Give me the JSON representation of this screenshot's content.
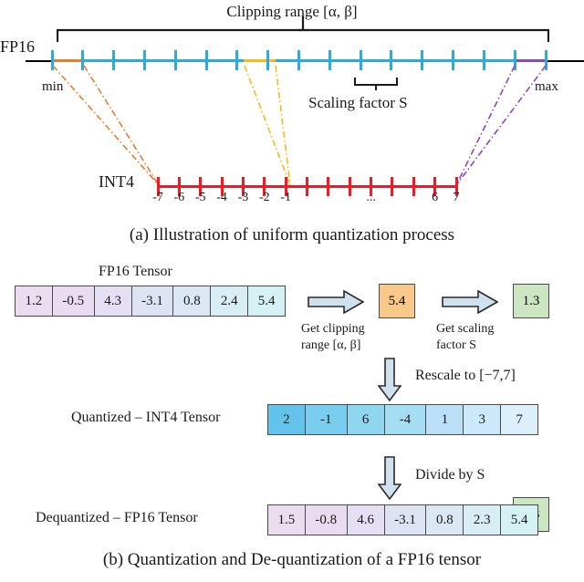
{
  "figure": {
    "caption_a": "(a)  Illustration of uniform quantization process",
    "caption_b": "(b)  Quantization and De-quantization of a FP16 tensor"
  },
  "panel_a": {
    "clipping_range_label": "Clipping range [α, β]",
    "fp16_axis_label": "FP16",
    "int4_axis_label": "INT4",
    "min_label": "min",
    "max_label": "max",
    "scaling_factor_label": "Scaling factor S",
    "int4_tick_labels": [
      "-7",
      "-6",
      "-5",
      "-4",
      "-3",
      "-2",
      "-1",
      "...",
      "6",
      "7"
    ],
    "colors": {
      "axis_black": "#000000",
      "fp16_blue": "#29abe2",
      "orange": "#f07a24",
      "yellow": "#fcb813",
      "purple": "#8e44c7",
      "int4_red": "#ed1c24"
    }
  },
  "panel_b": {
    "fp16_tensor_title": "FP16 Tensor",
    "quantized_tensor_title": "Quantized – INT4 Tensor",
    "dequantized_tensor_title": "Dequantized – FP16 Tensor",
    "fp16_tensor_values": [
      "1.2",
      "-0.5",
      "4.3",
      "-3.1",
      "0.8",
      "2.4",
      "5.4"
    ],
    "int4_tensor_values": [
      "2",
      "-1",
      "6",
      "-4",
      "1",
      "3",
      "7"
    ],
    "dequantized_tensor_values": [
      "1.5",
      "-0.8",
      "4.6",
      "-3.1",
      "0.8",
      "2.3",
      "5.4"
    ],
    "clip_value": "5.4",
    "scale_value": "1.3",
    "scale_value_2": "1.3",
    "step_get_clipping_line1": "Get clipping",
    "step_get_clipping_line2": "range [α, β]",
    "step_get_scaling_line1": "Get scaling",
    "step_get_scaling_line2": "factor S",
    "step_rescale": "Rescale to [−7,7]",
    "step_divide": "Divide by S",
    "colors": {
      "clip_box": "#f8c98a",
      "scale_box": "#cbe6c0",
      "arrow_fill": "#cfe0ee",
      "border": "#4a4a4a",
      "fp16_cells": [
        "#ecdcef",
        "#eadcf0",
        "#e4dff2",
        "#dde3f3",
        "#dbe8f4",
        "#d8edf4",
        "#d5f1f4"
      ],
      "int4_cells": [
        "#63c3ea",
        "#79cdee",
        "#8fd6f1",
        "#a5def3",
        "#badff6",
        "#cbe9f8",
        "#dcf0fb"
      ],
      "deq_cells": [
        "#ecdcef",
        "#eadcf0",
        "#e4dff2",
        "#dde3f3",
        "#dbe8f4",
        "#d8edf4",
        "#d5f1f4"
      ]
    }
  }
}
